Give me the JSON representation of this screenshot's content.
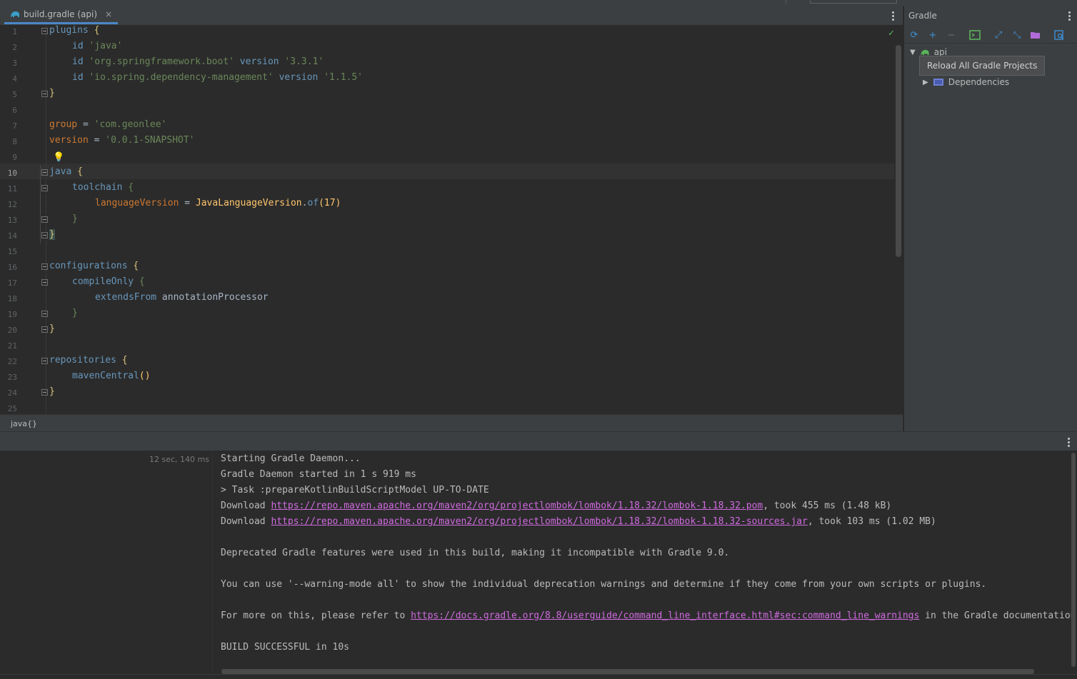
{
  "editor": {
    "tab_label": "build.gradle (api)",
    "close_glyph": "×",
    "check_glyph": "✓",
    "bulb_glyph": "💡",
    "lines": [
      {
        "n": "1"
      },
      {
        "n": "2"
      },
      {
        "n": "3"
      },
      {
        "n": "4"
      },
      {
        "n": "5"
      },
      {
        "n": "6"
      },
      {
        "n": "7"
      },
      {
        "n": "8"
      },
      {
        "n": "9"
      },
      {
        "n": "10"
      },
      {
        "n": "11"
      },
      {
        "n": "12"
      },
      {
        "n": "13"
      },
      {
        "n": "14"
      },
      {
        "n": "15"
      },
      {
        "n": "16"
      },
      {
        "n": "17"
      },
      {
        "n": "18"
      },
      {
        "n": "19"
      },
      {
        "n": "20"
      },
      {
        "n": "21"
      },
      {
        "n": "22"
      },
      {
        "n": "23"
      },
      {
        "n": "24"
      },
      {
        "n": "25"
      }
    ],
    "code": {
      "l1_plugins": "plugins",
      "l1_brace": " {",
      "l2_id": "id",
      "l2_str": " 'java'",
      "l3_id": "id",
      "l3_str": " 'org.springframework.boot'",
      "l3_version": " version",
      "l3_ver": " '3.3.1'",
      "l4_id": "id",
      "l4_str": " 'io.spring.dependency-management'",
      "l4_version": " version",
      "l4_ver": " '1.1.5'",
      "l5_brace": "}",
      "l7_group": "group",
      "l7_eq": " = ",
      "l7_val": "'com.geonlee'",
      "l8_version": "version",
      "l8_eq": " = ",
      "l8_val": "'0.0.1-SNAPSHOT'",
      "l10_java": "java",
      "l10_brace": " {",
      "l11_toolchain": "toolchain",
      "l11_brace": " {",
      "l12_lang": "languageVersion",
      "l12_eq": " = ",
      "l12_cls": "JavaLanguageVersion",
      "l12_dot": ".",
      "l12_of": "of",
      "l12_args": "(17)",
      "l13_brace": "}",
      "l14_brace": "}",
      "l16_conf": "configurations",
      "l16_brace": " {",
      "l17_comp": "compileOnly",
      "l17_brace": " {",
      "l18_ext": "extendsFrom",
      "l18_arg": " annotationProcessor",
      "l19_brace": "}",
      "l20_brace": "}",
      "l22_repo": "repositories",
      "l22_brace": " {",
      "l23_mc": "mavenCentral",
      "l23_paren": "()",
      "l24_brace": "}"
    }
  },
  "statusbar": {
    "breadcrumb": "java{}"
  },
  "gradle": {
    "title": "Gradle",
    "tree_root": "api",
    "dependencies": "Dependencies",
    "tooltip": "Reload All Gradle Projects",
    "toolbar_glyphs": {
      "reload": "⟳",
      "add": "+",
      "remove": "−",
      "expand": "⤢",
      "collapse": "⤡"
    }
  },
  "run": {
    "elapsed": "12 sec, 140 ms",
    "console": {
      "line1": "Starting Gradle Daemon...",
      "line2": "Gradle Daemon started in 1 s 919 ms",
      "line3": "> Task :prepareKotlinBuildScriptModel UP-TO-DATE",
      "dl1_prefix": "Download ",
      "dl1_link": "https://repo.maven.apache.org/maven2/org/projectlombok/lombok/1.18.32/lombok-1.18.32.pom",
      "dl1_suffix": ", took 455 ms (1.48 kB)",
      "dl2_prefix": "Download ",
      "dl2_link": "https://repo.maven.apache.org/maven2/org/projectlombok/lombok/1.18.32/lombok-1.18.32-sources.jar",
      "dl2_suffix": ", took 103 ms (1.02 MB)",
      "deprecated": "Deprecated Gradle features were used in this build, making it incompatible with Gradle 9.0.",
      "warning": "You can use '--warning-mode all' to show the individual deprecation warnings and determine if they come from your own scripts or plugins.",
      "more_prefix": "For more on this, please refer to ",
      "more_link": "https://docs.gradle.org/8.8/userguide/command_line_interface.html#sec:command_line_warnings",
      "more_suffix": " in the Gradle documentation.",
      "success": "BUILD SUCCESSFUL in 10s"
    }
  }
}
